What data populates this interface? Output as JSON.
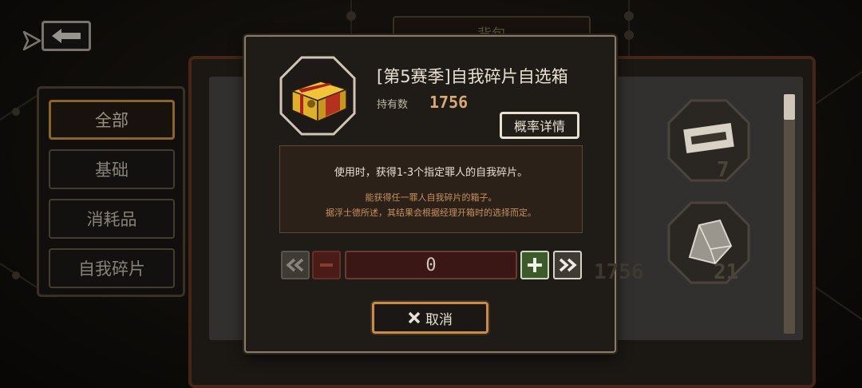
{
  "top_tab": {
    "label": "背包"
  },
  "categories": [
    {
      "label": "全部",
      "active": true
    },
    {
      "label": "基础",
      "active": false
    },
    {
      "label": "消耗品",
      "active": false
    },
    {
      "label": "自我碎片",
      "active": false
    }
  ],
  "inventory": {
    "visible_counts": [
      "7",
      "21",
      "1756"
    ]
  },
  "modal": {
    "title": "[第5赛季]自我碎片自选箱",
    "owned_label": "持有数",
    "owned_count": "1756",
    "probability_button": "概率详情",
    "description_main": "使用时，获得1-3个指定罪人的自我碎片。",
    "description_sub1": "能获得任一罪人自我碎片的箱子。",
    "description_sub2": "据浮士德所述，其结果会根据经理开箱时的选择而定。",
    "quantity": "0",
    "cancel_label": "取消"
  },
  "icons": [
    "back-arrow-icon",
    "navigation-icon",
    "double-chevron-left-icon",
    "minus-icon",
    "plus-icon",
    "double-chevron-right-icon",
    "close-icon",
    "box-icon",
    "shard-icon",
    "ticket-icon"
  ],
  "colors": {
    "accent": "#d89a3c",
    "owned": "#d9a877",
    "plus": "#3d5a2a",
    "minus": "#4a1c18"
  }
}
